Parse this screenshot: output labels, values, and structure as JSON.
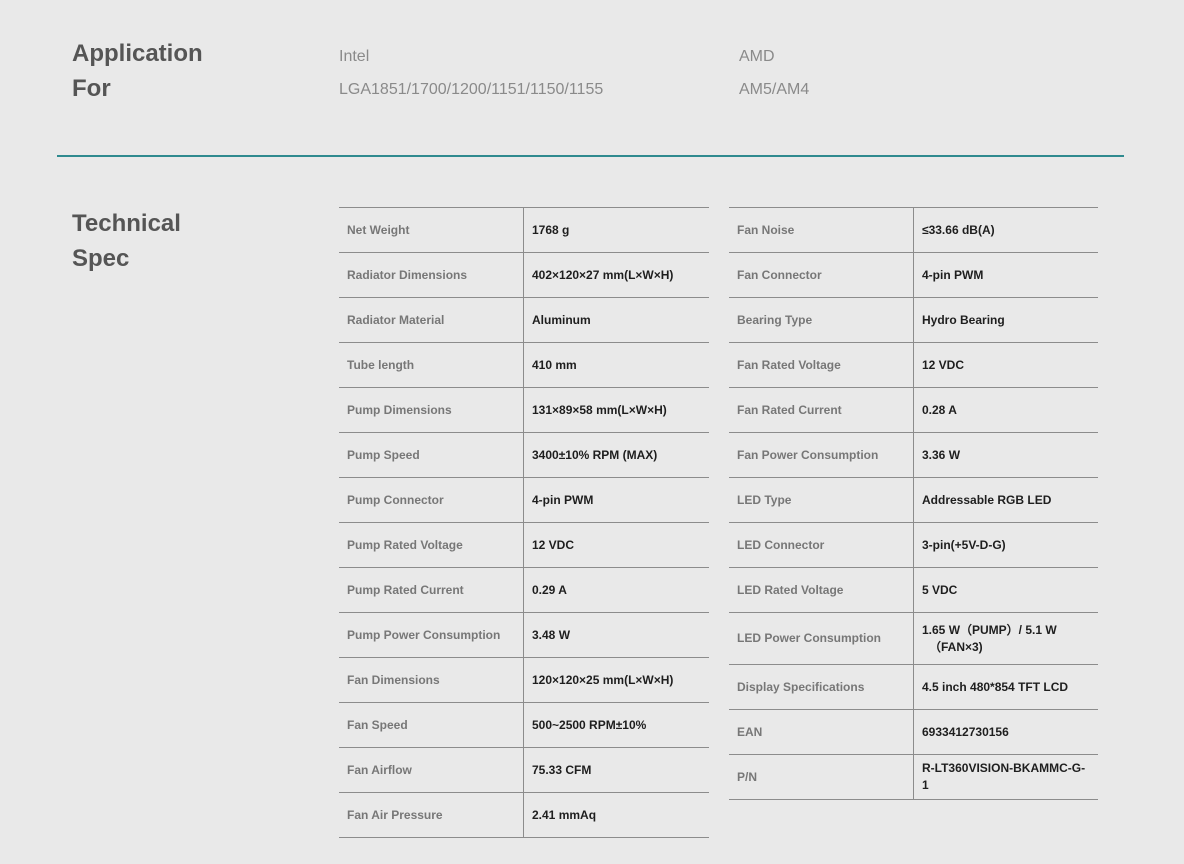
{
  "application": {
    "title_line1": "Application",
    "title_line2": "For",
    "intel": {
      "name": "Intel",
      "sockets": "LGA1851/1700/1200/1151/1150/1155"
    },
    "amd": {
      "name": "AMD",
      "sockets": "AM5/AM4"
    }
  },
  "technical": {
    "title_line1": "Technical",
    "title_line2": "Spec",
    "left": [
      {
        "label": "Net Weight",
        "value": "1768 g"
      },
      {
        "label": "Radiator Dimensions",
        "value": "402×120×27 mm(L×W×H)"
      },
      {
        "label": "Radiator Material",
        "value": "Aluminum"
      },
      {
        "label": "Tube length",
        "value": "410 mm"
      },
      {
        "label": "Pump Dimensions",
        "value": "131×89×58 mm(L×W×H)"
      },
      {
        "label": "Pump Speed",
        "value": "3400±10% RPM (MAX)"
      },
      {
        "label": "Pump Connector",
        "value": "4-pin PWM"
      },
      {
        "label": "Pump Rated Voltage",
        "value": "12 VDC"
      },
      {
        "label": "Pump Rated Current",
        "value": "0.29 A"
      },
      {
        "label": "Pump Power Consumption",
        "value": "3.48 W"
      },
      {
        "label": "Fan Dimensions",
        "value": "120×120×25 mm(L×W×H)"
      },
      {
        "label": "Fan Speed",
        "value": "500~2500 RPM±10%"
      },
      {
        "label": "Fan Airflow",
        "value": "75.33 CFM"
      },
      {
        "label": "Fan Air Pressure",
        "value": "2.41 mmAq"
      }
    ],
    "right": [
      {
        "label": "Fan Noise",
        "value": "≤33.66 dB(A)"
      },
      {
        "label": "Fan Connector",
        "value": "4-pin PWM"
      },
      {
        "label": "Bearing Type",
        "value": "Hydro Bearing"
      },
      {
        "label": "Fan Rated Voltage",
        "value": "12 VDC"
      },
      {
        "label": "Fan Rated Current",
        "value": "0.28 A"
      },
      {
        "label": "Fan Power Consumption",
        "value": "3.36 W"
      },
      {
        "label": "LED Type",
        "value": "Addressable RGB LED"
      },
      {
        "label": "LED Connector",
        "value": "3-pin(+5V-D-G)"
      },
      {
        "label": "LED Rated Voltage",
        "value": "5 VDC"
      },
      {
        "label": "LED Power Consumption",
        "value": "1.65 W（PUMP）/ 5.1 W",
        "value_line2": "（FAN×3)"
      },
      {
        "label": "Display Specifications",
        "value": "4.5 inch 480*854 TFT LCD"
      },
      {
        "label": "EAN",
        "value": "6933412730156"
      },
      {
        "label": "P/N",
        "value": "R-LT360VISION-BKAMMC-G-1"
      }
    ]
  }
}
